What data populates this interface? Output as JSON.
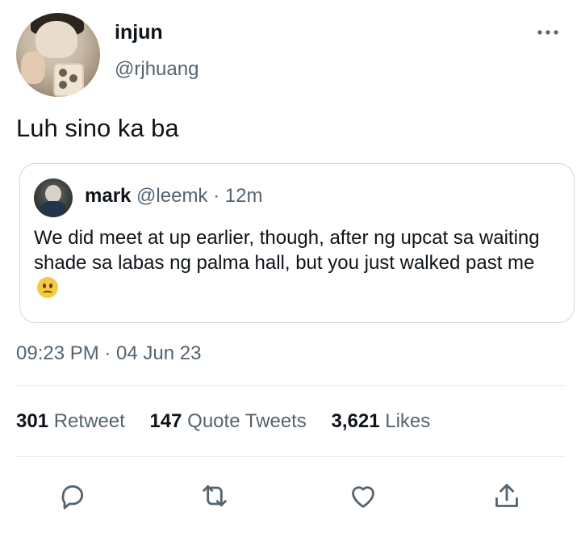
{
  "user": {
    "display_name": "injun",
    "handle": "@rjhuang",
    "avatar_icon": "profile-photo"
  },
  "tweet": {
    "text": "Luh sino ka ba",
    "timestamp": "09:23 PM · 04 Jun 23"
  },
  "quoted_tweet": {
    "display_name": "mark",
    "handle": "@leemk",
    "separator": "·",
    "age": "12m",
    "text": "We did meet at up earlier, though, after ng upcat sa waiting shade sa labas ng palma hall, but you just walked past me",
    "emoji_icon": "confused-face-emoji"
  },
  "stats": {
    "retweets_count": "301",
    "retweets_label": "Retweet",
    "quotes_count": "147",
    "quotes_label": "Quote Tweets",
    "likes_count": "3,621",
    "likes_label": "Likes"
  },
  "actions": {
    "reply_icon": "reply-icon",
    "retweet_icon": "retweet-icon",
    "like_icon": "heart-icon",
    "share_icon": "share-icon"
  },
  "colors": {
    "text": "#0f1419",
    "secondary": "#536471",
    "border": "#cfd9de"
  }
}
